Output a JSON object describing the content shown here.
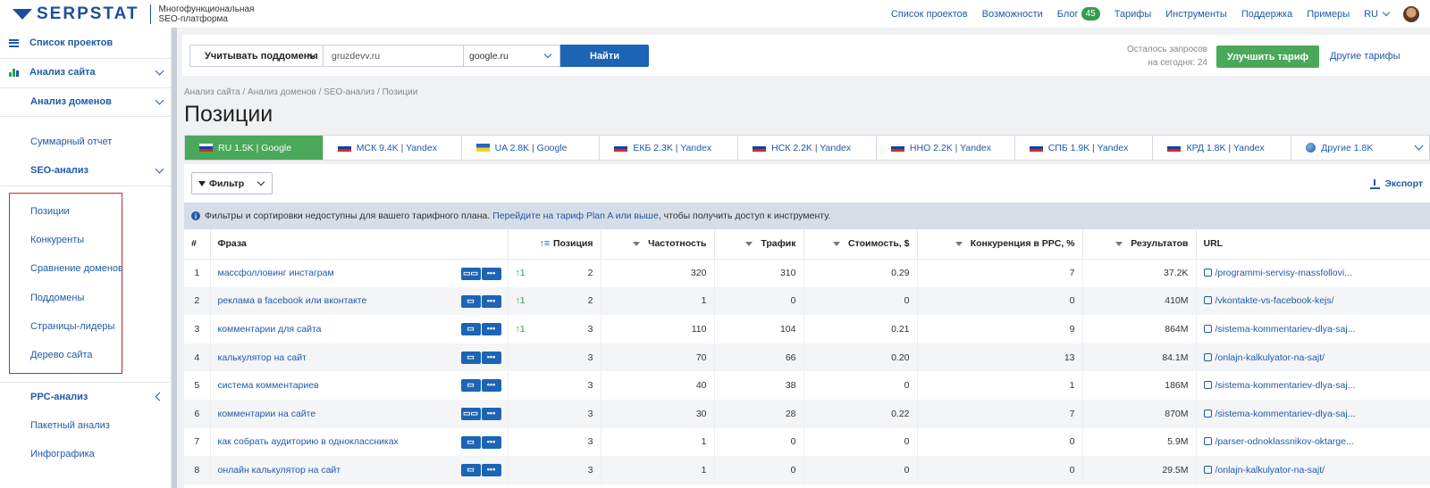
{
  "header": {
    "logo_text": "SERPSTAT",
    "logo_sub_line1": "Многофункциональная",
    "logo_sub_line2": "SEO-платформа",
    "nav": [
      "Список проектов",
      "Возможности",
      "Блог",
      "Тарифы",
      "Инструменты",
      "Поддержка",
      "Примеры"
    ],
    "blog_badge": "45",
    "lang": "RU"
  },
  "sidebar": {
    "projects": "Список проектов",
    "site_analysis": "Анализ сайта",
    "domain_analysis": "Анализ доменов",
    "summary": "Суммарный отчет",
    "seo_analysis": "SEO-анализ",
    "items": [
      "Позиции",
      "Конкуренты",
      "Сравнение доменов",
      "Поддомены",
      "Страницы-лидеры",
      "Дерево сайта"
    ],
    "ppc": "PPC-анализ",
    "batch": "Пакетный анализ",
    "infographics": "Инфографика"
  },
  "search": {
    "subdomains_label": "Учитывать поддомены",
    "domain_value": "gruzdevv.ru",
    "engine_value": "google.ru",
    "find_label": "Найти",
    "remaining_line1": "Осталось запросов",
    "remaining_line2": "на сегодня: 24",
    "upgrade_label": "Улучшить тариф",
    "other_tariffs": "Другие тарифы"
  },
  "breadcrumb": "Анализ сайта / Анализ доменов / SEO-анализ / Позиции",
  "page_title": "Позиции",
  "regions": [
    {
      "flag": "ru",
      "label": "RU 1.5K | Google"
    },
    {
      "flag": "ru",
      "label": "МСК 9.4K | Yandex"
    },
    {
      "flag": "ua",
      "label": "UA 2.8K | Google"
    },
    {
      "flag": "ru",
      "label": "ЕКБ 2.3K | Yandex"
    },
    {
      "flag": "ru",
      "label": "НСК 2.2K | Yandex"
    },
    {
      "flag": "ru",
      "label": "ННО 2.2K | Yandex"
    },
    {
      "flag": "ru",
      "label": "СПБ 1.9K | Yandex"
    },
    {
      "flag": "ru",
      "label": "КРД 1.8K | Yandex"
    },
    {
      "flag": "globe",
      "label": "Другие 1.8K"
    }
  ],
  "toolbar": {
    "filter_label": "Фильтр",
    "export_label": "Экспорт"
  },
  "info": {
    "before": "Фильтры и сортировки недоступны для вашего тарифного плана. ",
    "link": "Перейдите на тариф Plan A или выше",
    "after": ", чтобы получить доступ к инструменту."
  },
  "table": {
    "headers": [
      "#",
      "Фраза",
      "Позиция",
      "Частотность",
      "Трафик",
      "Стоимость, $",
      "Конкуренция в PPC, %",
      "Результатов",
      "URL"
    ],
    "rows": [
      {
        "n": "1",
        "phrase": "массфолловинг инстаграм",
        "trend": "↑1",
        "pos": "2",
        "freq": "320",
        "traffic": "310",
        "cost": "0.29",
        "comp": "7",
        "results": "37.2K",
        "url": "/programmi-servisy-massfollovi..."
      },
      {
        "n": "2",
        "phrase": "реклама в facebook или вконтакте",
        "trend": "↑1",
        "pos": "2",
        "freq": "1",
        "traffic": "0",
        "cost": "0",
        "comp": "0",
        "results": "410M",
        "url": "/vkontakte-vs-facebook-kejs/"
      },
      {
        "n": "3",
        "phrase": "комментарии для сайта",
        "trend": "↑1",
        "pos": "3",
        "freq": "110",
        "traffic": "104",
        "cost": "0.21",
        "comp": "9",
        "results": "864M",
        "url": "/sistema-kommentariev-dlya-saj..."
      },
      {
        "n": "4",
        "phrase": "калькулятор на сайт",
        "trend": "",
        "pos": "3",
        "freq": "70",
        "traffic": "66",
        "cost": "0.20",
        "comp": "13",
        "results": "84.1M",
        "url": "/onlajn-kalkulyator-na-sajt/"
      },
      {
        "n": "5",
        "phrase": "система комментариев",
        "trend": "",
        "pos": "3",
        "freq": "40",
        "traffic": "38",
        "cost": "0",
        "comp": "1",
        "results": "186M",
        "url": "/sistema-kommentariev-dlya-saj..."
      },
      {
        "n": "6",
        "phrase": "комментарии на сайте",
        "trend": "",
        "pos": "3",
        "freq": "30",
        "traffic": "28",
        "cost": "0.22",
        "comp": "7",
        "results": "870M",
        "url": "/sistema-kommentariev-dlya-saj..."
      },
      {
        "n": "7",
        "phrase": "как собрать аудиторию в одноклассниках",
        "trend": "",
        "pos": "3",
        "freq": "1",
        "traffic": "0",
        "cost": "0",
        "comp": "0",
        "results": "5.9M",
        "url": "/parser-odnoklassnikov-oktarge..."
      },
      {
        "n": "8",
        "phrase": "онлайн калькулятор на сайт",
        "trend": "",
        "pos": "3",
        "freq": "1",
        "traffic": "0",
        "cost": "0",
        "comp": "0",
        "results": "29.5M",
        "url": "/onlajn-kalkulyator-na-sajt/"
      }
    ]
  },
  "colors": {
    "brand": "#1b4f9c",
    "accent_green": "#4aa85a",
    "button_blue": "#1c64b4",
    "highlight_red": "#c22a2a"
  }
}
